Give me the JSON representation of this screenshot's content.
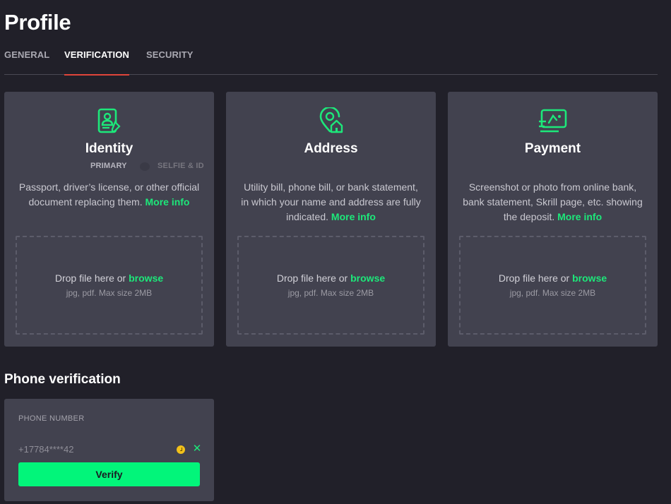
{
  "page": {
    "title": "Profile"
  },
  "tabs": [
    {
      "label": "GENERAL",
      "active": false
    },
    {
      "label": "VERIFICATION",
      "active": true
    },
    {
      "label": "SECURITY",
      "active": false
    }
  ],
  "theme": {
    "accent": "#1de87a",
    "button": "#02f57a",
    "tab_underline": "#e0453a",
    "card_bg": "#42424f",
    "page_bg": "#212029",
    "pending": "#f2c11a"
  },
  "cards": [
    {
      "icon": "id-card-icon",
      "title": "Identity",
      "subtabs": [
        "PRIMARY",
        "SELFIE & ID"
      ],
      "description": "Passport, driver’s license, or other official document replacing them.",
      "more_info": "More info",
      "drop_text": "Drop file here or",
      "browse": "browse",
      "hint": "jpg, pdf. Max size 2MB"
    },
    {
      "icon": "location-home-icon",
      "title": "Address",
      "description": "Utility bill, phone bill, or bank statement, in which your name and address are fully indicated.",
      "more_info": "More info",
      "drop_text": "Drop file here or",
      "browse": "browse",
      "hint": "jpg, pdf. Max size 2MB"
    },
    {
      "icon": "payment-card-icon",
      "title": "Payment",
      "description": "Screenshot or photo from online bank, bank statement, Skrill page, etc. showing the deposit.",
      "more_info": "More info",
      "drop_text": "Drop file here or",
      "browse": "browse",
      "hint": "jpg, pdf. Max size 2MB"
    }
  ],
  "phone": {
    "section_title": "Phone verification",
    "label": "PHONE NUMBER",
    "value": "+17784****42",
    "status_icon": "pending-clock-icon",
    "clear_icon": "close-icon",
    "clear_glyph": "✕",
    "verify_label": "Verify"
  }
}
